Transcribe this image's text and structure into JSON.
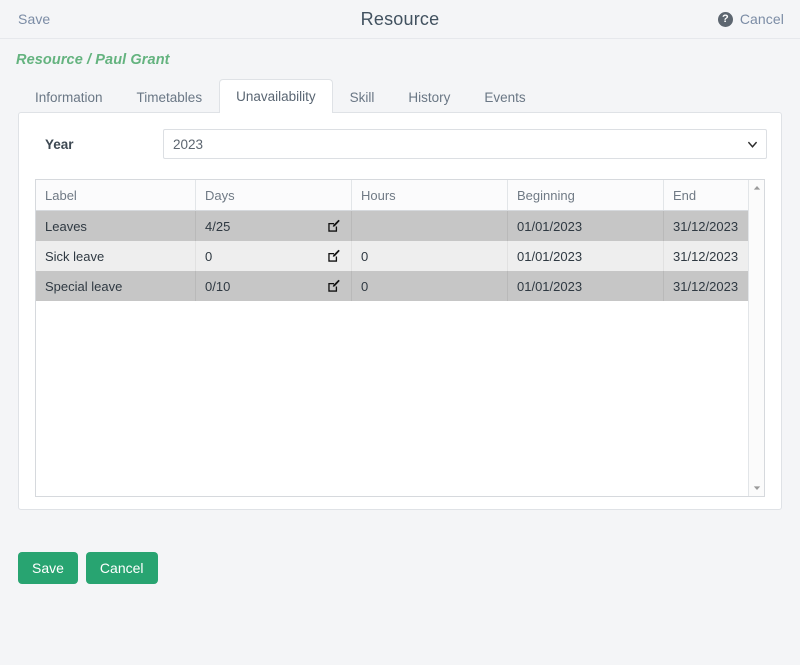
{
  "topbar": {
    "save_label": "Save",
    "title": "Resource",
    "help_icon": "help-circle-icon",
    "help_glyph": "?",
    "cancel_label": "Cancel"
  },
  "breadcrumb": "Resource / Paul Grant",
  "tabs": [
    {
      "label": "Information",
      "active": false
    },
    {
      "label": "Timetables",
      "active": false
    },
    {
      "label": "Unavailability",
      "active": true
    },
    {
      "label": "Skill",
      "active": false
    },
    {
      "label": "History",
      "active": false
    },
    {
      "label": "Events",
      "active": false
    }
  ],
  "form": {
    "year_label": "Year",
    "year_value": "2023",
    "year_options": [
      "2023"
    ],
    "chevron_icon": "chevron-down-icon"
  },
  "table": {
    "columns": [
      "Label",
      "Days",
      "Hours",
      "Beginning",
      "End"
    ],
    "edit_icon": "edit-pencil-icon",
    "rows": [
      {
        "label": "Leaves",
        "days": "4/25",
        "hours": "",
        "beginning": "01/01/2023",
        "end": "31/12/2023",
        "style": "row-dark"
      },
      {
        "label": "Sick leave",
        "days": "0",
        "hours": "0",
        "beginning": "01/01/2023",
        "end": "31/12/2023",
        "style": "row-light"
      },
      {
        "label": "Special leave",
        "days": "0/10",
        "hours": "0",
        "beginning": "01/01/2023",
        "end": "31/12/2023",
        "style": "row-dark"
      }
    ],
    "scrollbar": {
      "up_icon": "scroll-up-arrow-icon",
      "down_icon": "scroll-down-arrow-icon"
    }
  },
  "footer": {
    "save_label": "Save",
    "cancel_label": "Cancel"
  },
  "colors": {
    "accent_green": "#28a471",
    "breadcrumb_green": "#64b37f",
    "link_blue": "#7b8ca5",
    "page_background": "#f4f5f7",
    "row_selected": "#c6c6c6",
    "row_alt": "#eeeeee"
  }
}
